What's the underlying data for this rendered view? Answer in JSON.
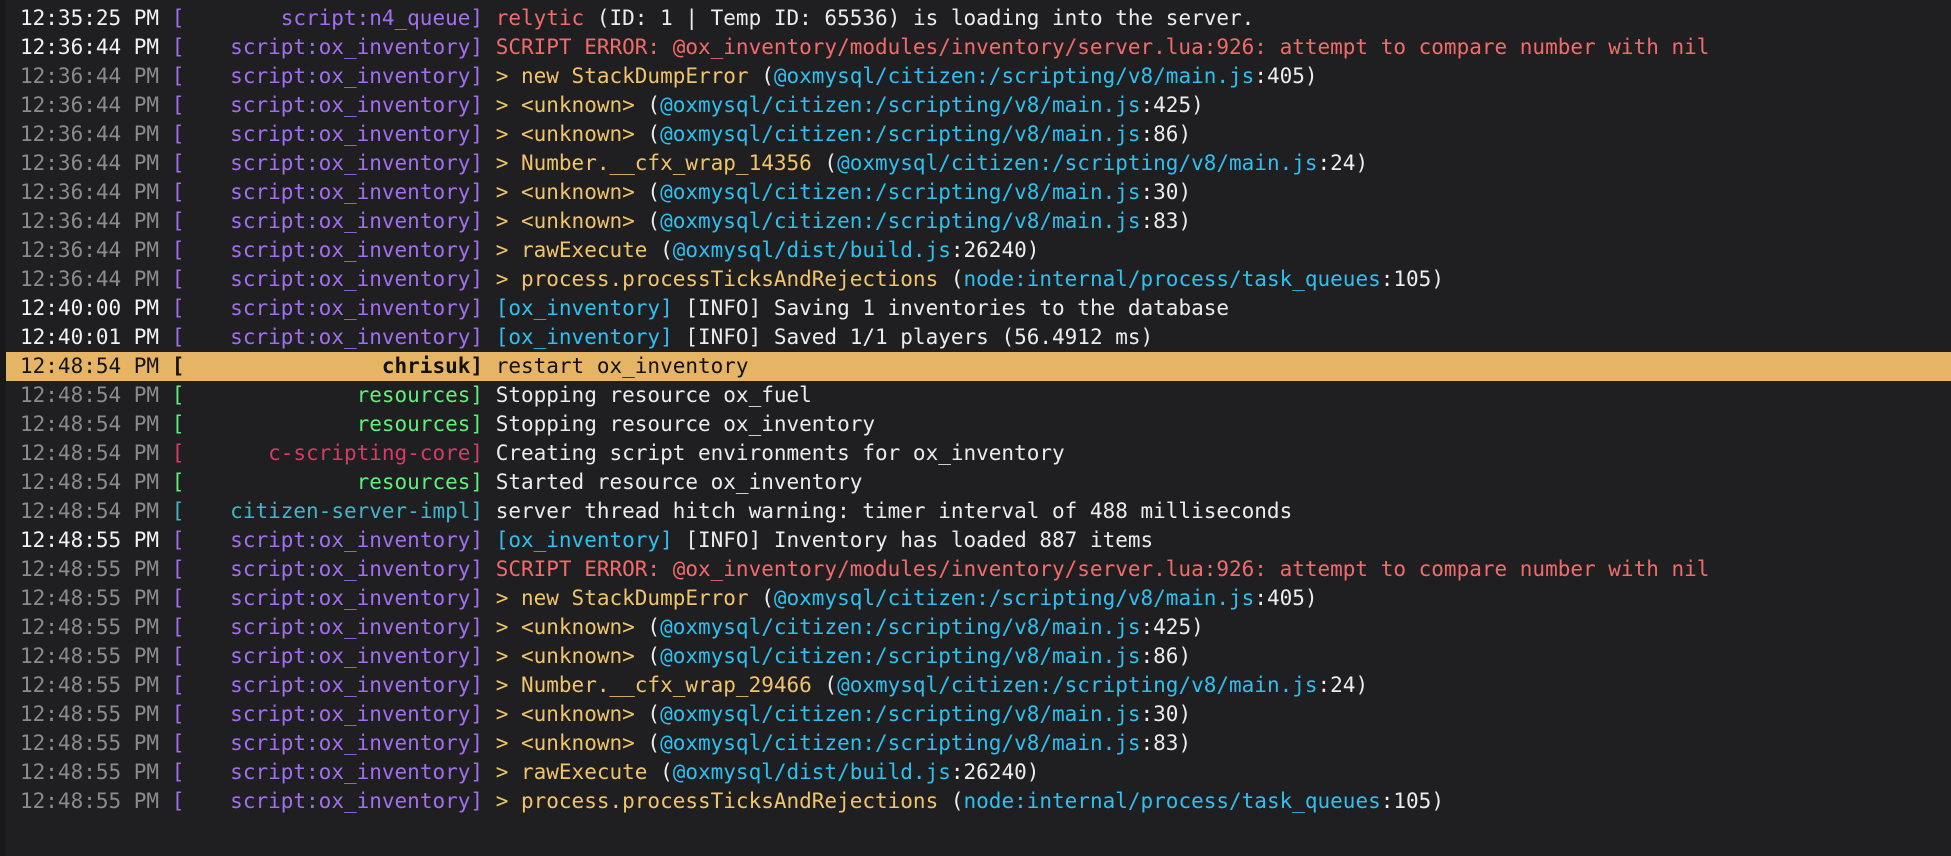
{
  "colors": {
    "background": "#1f1f21",
    "highlight": "#e5b565",
    "script_source": "#a26ef0",
    "resources_source": "#5df07a",
    "scripting_core_source": "#d83a67",
    "citizen_server_source": "#3fb6c9",
    "error_text": "#f26b6b",
    "function_name": "#f0c46a",
    "path_link": "#2ec0f0"
  },
  "console": {
    "lines": [
      {
        "ts": "12:35:25 PM",
        "ts_bright": true,
        "source": "script:n4_queue",
        "src_class": "",
        "hl": false,
        "parts": [
          {
            "c": "err",
            "t": "relytic"
          },
          {
            "c": "txt",
            "t": " (ID: 1 | Temp ID: 65536) is loading into the server."
          }
        ]
      },
      {
        "ts": "12:36:44 PM",
        "ts_bright": true,
        "source": "script:ox_inventory",
        "src_class": "",
        "hl": false,
        "parts": [
          {
            "c": "err",
            "t": "SCRIPT ERROR: @ox_inventory/modules/inventory/server.lua:926: attempt to compare number with nil"
          }
        ]
      },
      {
        "ts": "12:36:44 PM",
        "ts_bright": false,
        "source": "script:ox_inventory",
        "src_class": "",
        "hl": false,
        "parts": [
          {
            "c": "fn",
            "t": "> new StackDumpError"
          },
          {
            "c": "txt",
            "t": " ("
          },
          {
            "c": "path",
            "t": "@oxmysql/citizen:/scripting/v8/main.js"
          },
          {
            "c": "txt",
            "t": ":405)"
          }
        ]
      },
      {
        "ts": "12:36:44 PM",
        "ts_bright": false,
        "source": "script:ox_inventory",
        "src_class": "",
        "hl": false,
        "parts": [
          {
            "c": "fn",
            "t": "> <unknown>"
          },
          {
            "c": "txt",
            "t": " ("
          },
          {
            "c": "path",
            "t": "@oxmysql/citizen:/scripting/v8/main.js"
          },
          {
            "c": "txt",
            "t": ":425)"
          }
        ]
      },
      {
        "ts": "12:36:44 PM",
        "ts_bright": false,
        "source": "script:ox_inventory",
        "src_class": "",
        "hl": false,
        "parts": [
          {
            "c": "fn",
            "t": "> <unknown>"
          },
          {
            "c": "txt",
            "t": " ("
          },
          {
            "c": "path",
            "t": "@oxmysql/citizen:/scripting/v8/main.js"
          },
          {
            "c": "txt",
            "t": ":86)"
          }
        ]
      },
      {
        "ts": "12:36:44 PM",
        "ts_bright": false,
        "source": "script:ox_inventory",
        "src_class": "",
        "hl": false,
        "parts": [
          {
            "c": "fn",
            "t": "> Number.__cfx_wrap_14356"
          },
          {
            "c": "txt",
            "t": " ("
          },
          {
            "c": "path",
            "t": "@oxmysql/citizen:/scripting/v8/main.js"
          },
          {
            "c": "txt",
            "t": ":24)"
          }
        ]
      },
      {
        "ts": "12:36:44 PM",
        "ts_bright": false,
        "source": "script:ox_inventory",
        "src_class": "",
        "hl": false,
        "parts": [
          {
            "c": "fn",
            "t": "> <unknown>"
          },
          {
            "c": "txt",
            "t": " ("
          },
          {
            "c": "path",
            "t": "@oxmysql/citizen:/scripting/v8/main.js"
          },
          {
            "c": "txt",
            "t": ":30)"
          }
        ]
      },
      {
        "ts": "12:36:44 PM",
        "ts_bright": false,
        "source": "script:ox_inventory",
        "src_class": "",
        "hl": false,
        "parts": [
          {
            "c": "fn",
            "t": "> <unknown>"
          },
          {
            "c": "txt",
            "t": " ("
          },
          {
            "c": "path",
            "t": "@oxmysql/citizen:/scripting/v8/main.js"
          },
          {
            "c": "txt",
            "t": ":83)"
          }
        ]
      },
      {
        "ts": "12:36:44 PM",
        "ts_bright": false,
        "source": "script:ox_inventory",
        "src_class": "",
        "hl": false,
        "parts": [
          {
            "c": "fn",
            "t": "> rawExecute"
          },
          {
            "c": "txt",
            "t": " ("
          },
          {
            "c": "path",
            "t": "@oxmysql/dist/build.js"
          },
          {
            "c": "txt",
            "t": ":26240)"
          }
        ]
      },
      {
        "ts": "12:36:44 PM",
        "ts_bright": false,
        "source": "script:ox_inventory",
        "src_class": "",
        "hl": false,
        "parts": [
          {
            "c": "fn",
            "t": "> process.processTicksAndRejections"
          },
          {
            "c": "txt",
            "t": " ("
          },
          {
            "c": "path",
            "t": "node:internal/process/task_queues"
          },
          {
            "c": "txt",
            "t": ":105)"
          }
        ]
      },
      {
        "ts": "12:40:00 PM",
        "ts_bright": true,
        "source": "script:ox_inventory",
        "src_class": "",
        "hl": false,
        "parts": [
          {
            "c": "tag",
            "t": "[ox_inventory]"
          },
          {
            "c": "txt",
            "t": " [INFO] Saving 1 inventories to the database"
          }
        ]
      },
      {
        "ts": "12:40:01 PM",
        "ts_bright": true,
        "source": "script:ox_inventory",
        "src_class": "",
        "hl": false,
        "parts": [
          {
            "c": "tag",
            "t": "[ox_inventory]"
          },
          {
            "c": "txt",
            "t": " [INFO] Saved 1/1 players (56.4912 ms)"
          }
        ]
      },
      {
        "ts": "12:48:54 PM",
        "ts_bright": true,
        "source": "chrisuk",
        "src_class": "black",
        "hl": true,
        "parts": [
          {
            "c": "txt",
            "t": "restart ox_inventory"
          }
        ]
      },
      {
        "ts": "12:48:54 PM",
        "ts_bright": false,
        "source": "resources",
        "src_class": "green",
        "hl": false,
        "parts": [
          {
            "c": "txt",
            "t": "Stopping resource ox_fuel"
          }
        ]
      },
      {
        "ts": "12:48:54 PM",
        "ts_bright": false,
        "source": "resources",
        "src_class": "green",
        "hl": false,
        "parts": [
          {
            "c": "txt",
            "t": "Stopping resource ox_inventory"
          }
        ]
      },
      {
        "ts": "12:48:54 PM",
        "ts_bright": false,
        "source": "c-scripting-core",
        "src_class": "red",
        "hl": false,
        "parts": [
          {
            "c": "txt",
            "t": "Creating script environments for ox_inventory"
          }
        ]
      },
      {
        "ts": "12:48:54 PM",
        "ts_bright": false,
        "source": "resources",
        "src_class": "green",
        "hl": false,
        "parts": [
          {
            "c": "txt",
            "t": "Started resource ox_inventory"
          }
        ]
      },
      {
        "ts": "12:48:54 PM",
        "ts_bright": false,
        "source": "citizen-server-impl",
        "src_class": "cyan",
        "hl": false,
        "parts": [
          {
            "c": "txt",
            "t": "server thread hitch warning: timer interval of 488 milliseconds"
          }
        ]
      },
      {
        "ts": "12:48:55 PM",
        "ts_bright": true,
        "source": "script:ox_inventory",
        "src_class": "",
        "hl": false,
        "parts": [
          {
            "c": "tag",
            "t": "[ox_inventory]"
          },
          {
            "c": "txt",
            "t": " [INFO] Inventory has loaded 887 items"
          }
        ]
      },
      {
        "ts": "12:48:55 PM",
        "ts_bright": false,
        "source": "script:ox_inventory",
        "src_class": "",
        "hl": false,
        "parts": [
          {
            "c": "err",
            "t": "SCRIPT ERROR: @ox_inventory/modules/inventory/server.lua:926: attempt to compare number with nil"
          }
        ]
      },
      {
        "ts": "12:48:55 PM",
        "ts_bright": false,
        "source": "script:ox_inventory",
        "src_class": "",
        "hl": false,
        "parts": [
          {
            "c": "fn",
            "t": "> new StackDumpError"
          },
          {
            "c": "txt",
            "t": " ("
          },
          {
            "c": "path",
            "t": "@oxmysql/citizen:/scripting/v8/main.js"
          },
          {
            "c": "txt",
            "t": ":405)"
          }
        ]
      },
      {
        "ts": "12:48:55 PM",
        "ts_bright": false,
        "source": "script:ox_inventory",
        "src_class": "",
        "hl": false,
        "parts": [
          {
            "c": "fn",
            "t": "> <unknown>"
          },
          {
            "c": "txt",
            "t": " ("
          },
          {
            "c": "path",
            "t": "@oxmysql/citizen:/scripting/v8/main.js"
          },
          {
            "c": "txt",
            "t": ":425)"
          }
        ]
      },
      {
        "ts": "12:48:55 PM",
        "ts_bright": false,
        "source": "script:ox_inventory",
        "src_class": "",
        "hl": false,
        "parts": [
          {
            "c": "fn",
            "t": "> <unknown>"
          },
          {
            "c": "txt",
            "t": " ("
          },
          {
            "c": "path",
            "t": "@oxmysql/citizen:/scripting/v8/main.js"
          },
          {
            "c": "txt",
            "t": ":86)"
          }
        ]
      },
      {
        "ts": "12:48:55 PM",
        "ts_bright": false,
        "source": "script:ox_inventory",
        "src_class": "",
        "hl": false,
        "parts": [
          {
            "c": "fn",
            "t": "> Number.__cfx_wrap_29466"
          },
          {
            "c": "txt",
            "t": " ("
          },
          {
            "c": "path",
            "t": "@oxmysql/citizen:/scripting/v8/main.js"
          },
          {
            "c": "txt",
            "t": ":24)"
          }
        ]
      },
      {
        "ts": "12:48:55 PM",
        "ts_bright": false,
        "source": "script:ox_inventory",
        "src_class": "",
        "hl": false,
        "parts": [
          {
            "c": "fn",
            "t": "> <unknown>"
          },
          {
            "c": "txt",
            "t": " ("
          },
          {
            "c": "path",
            "t": "@oxmysql/citizen:/scripting/v8/main.js"
          },
          {
            "c": "txt",
            "t": ":30)"
          }
        ]
      },
      {
        "ts": "12:48:55 PM",
        "ts_bright": false,
        "source": "script:ox_inventory",
        "src_class": "",
        "hl": false,
        "parts": [
          {
            "c": "fn",
            "t": "> <unknown>"
          },
          {
            "c": "txt",
            "t": " ("
          },
          {
            "c": "path",
            "t": "@oxmysql/citizen:/scripting/v8/main.js"
          },
          {
            "c": "txt",
            "t": ":83)"
          }
        ]
      },
      {
        "ts": "12:48:55 PM",
        "ts_bright": false,
        "source": "script:ox_inventory",
        "src_class": "",
        "hl": false,
        "parts": [
          {
            "c": "fn",
            "t": "> rawExecute"
          },
          {
            "c": "txt",
            "t": " ("
          },
          {
            "c": "path",
            "t": "@oxmysql/dist/build.js"
          },
          {
            "c": "txt",
            "t": ":26240)"
          }
        ]
      },
      {
        "ts": "12:48:55 PM",
        "ts_bright": false,
        "source": "script:ox_inventory",
        "src_class": "",
        "hl": false,
        "parts": [
          {
            "c": "fn",
            "t": "> process.processTicksAndRejections"
          },
          {
            "c": "txt",
            "t": " ("
          },
          {
            "c": "path",
            "t": "node:internal/process/task_queues"
          },
          {
            "c": "txt",
            "t": ":105)"
          }
        ]
      }
    ]
  }
}
